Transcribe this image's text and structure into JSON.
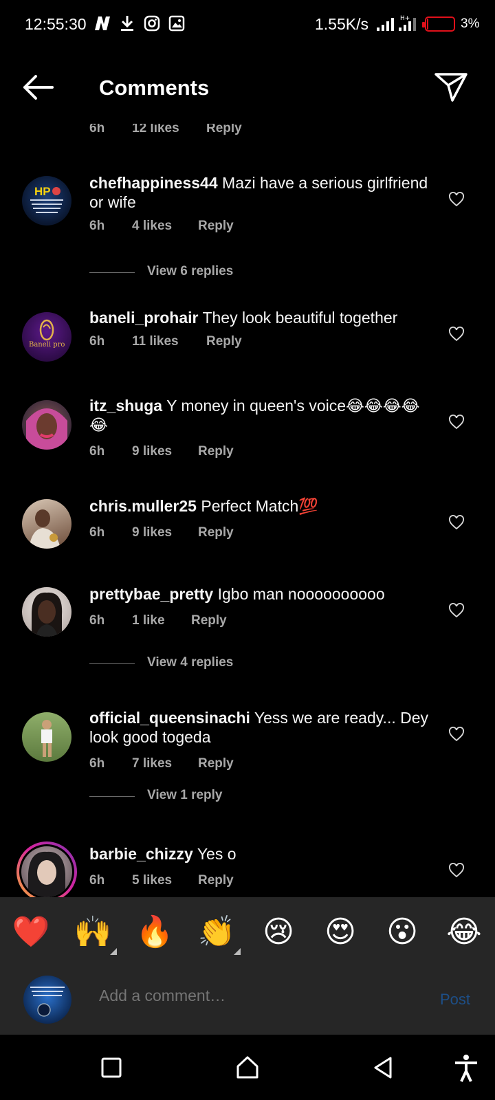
{
  "status_bar": {
    "time": "12:55:30",
    "net_speed": "1.55K/s",
    "battery_percent": "3%",
    "battery_level": 0.03,
    "icons": [
      "n-app-icon",
      "download-icon",
      "instagram-icon",
      "image-icon",
      "signal-icon",
      "signal-icon",
      "battery-icon"
    ]
  },
  "header": {
    "title": "Comments"
  },
  "partial_comment": {
    "time": "6h",
    "likes": "12 likes",
    "reply": "Reply"
  },
  "comments": [
    {
      "user": "chefhappiness44",
      "text": "Mazi have a serious girlfriend or wife",
      "time": "6h",
      "likes": "4 likes",
      "reply": "Reply",
      "view_replies": "View 6 replies"
    },
    {
      "user": "baneli_prohair",
      "text": "They look beautiful together",
      "time": "6h",
      "likes": "11 likes",
      "reply": "Reply"
    },
    {
      "user": "itz_shuga",
      "text": "Y money in queen's voice😂😂😂😂😂",
      "time": "6h",
      "likes": "9 likes",
      "reply": "Reply"
    },
    {
      "user": "chris.muller25",
      "text": "Perfect Match💯",
      "time": "6h",
      "likes": "9 likes",
      "reply": "Reply"
    },
    {
      "user": "prettybae_pretty",
      "text": "Igbo man noooooooooo",
      "time": "6h",
      "likes": "1 like",
      "reply": "Reply",
      "view_replies": "View 4 replies"
    },
    {
      "user": "official_queensinachi",
      "text": "Yess we are ready... Dey look good togeda",
      "time": "6h",
      "likes": "7 likes",
      "reply": "Reply",
      "view_replies": "View 1 reply"
    },
    {
      "user": "barbie_chizzy",
      "text": "Yes o",
      "time": "6h",
      "likes": "5 likes",
      "reply": "Reply"
    }
  ],
  "emoji_bar": [
    "❤️",
    "🙌",
    "🔥",
    "👏",
    "😢",
    "😍",
    "😮",
    "😂"
  ],
  "comment_input": {
    "placeholder": "Add a comment…",
    "post_label": "Post"
  },
  "avatar_logo_text": "HP",
  "avatar_logo_text_2": "Baneli pro",
  "colors": {
    "background": "#000000",
    "panel": "#262626",
    "muted_text": "#a8a8a8",
    "post_button": "#1d4f88",
    "battery_low": "#e0101a",
    "story_ring": "#d6249f"
  }
}
